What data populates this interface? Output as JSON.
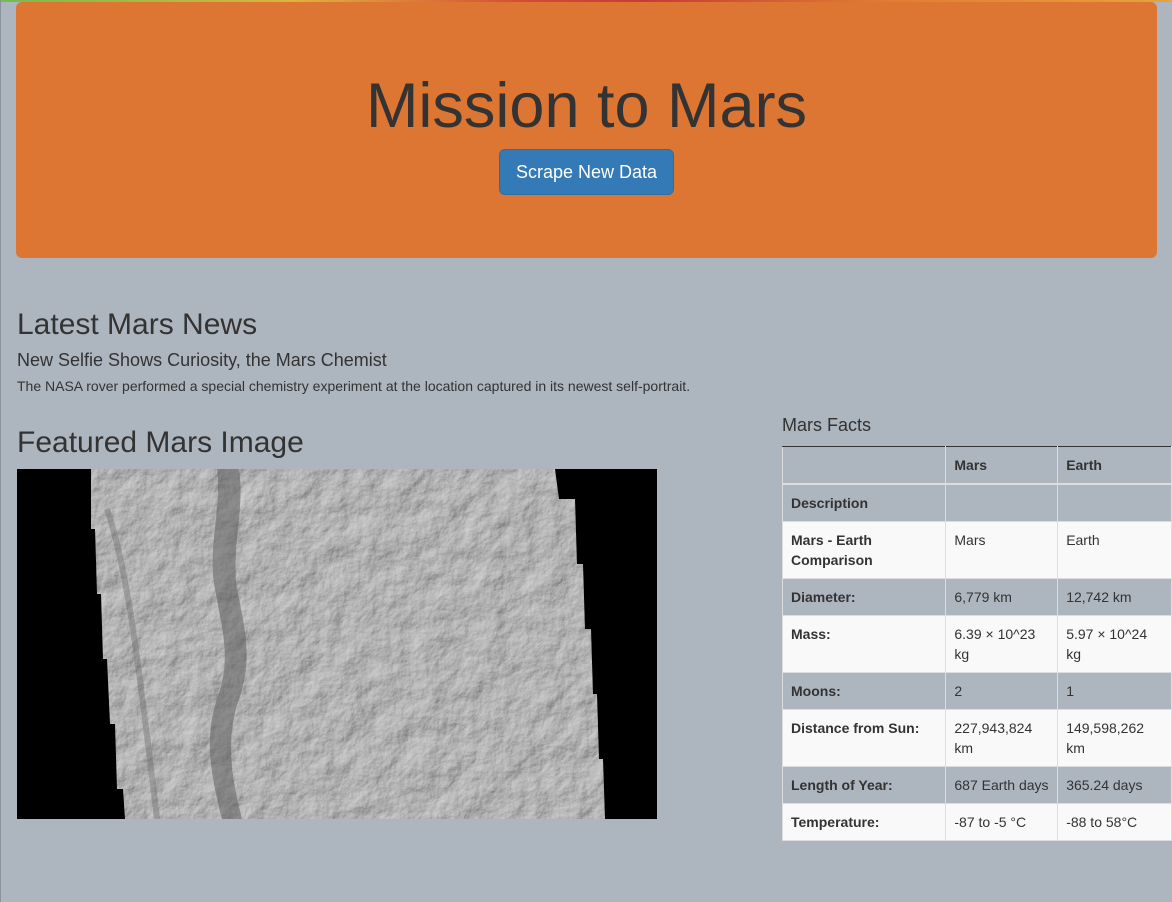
{
  "header": {
    "title": "Mission to Mars",
    "scrape_button_label": "Scrape New Data"
  },
  "news": {
    "heading": "Latest Mars News",
    "title": "New Selfie Shows Curiosity, the Mars Chemist",
    "paragraph": "The NASA rover performed a special chemistry experiment at the location captured in its newest self-portrait."
  },
  "featured_image": {
    "heading": "Featured Mars Image"
  },
  "facts": {
    "heading": "Mars Facts",
    "columns": [
      "",
      "Mars",
      "Earth"
    ],
    "rows": [
      {
        "label": "Description",
        "mars": "",
        "earth": ""
      },
      {
        "label": "Mars - Earth Comparison",
        "mars": "Mars",
        "earth": "Earth"
      },
      {
        "label": "Diameter:",
        "mars": "6,779 km",
        "earth": "12,742 km"
      },
      {
        "label": "Mass:",
        "mars": "6.39 × 10^23 kg",
        "earth": "5.97 × 10^24 kg"
      },
      {
        "label": "Moons:",
        "mars": "2",
        "earth": "1"
      },
      {
        "label": "Distance from Sun:",
        "mars": "227,943,824 km",
        "earth": "149,598,262 km"
      },
      {
        "label": "Length of Year:",
        "mars": "687 Earth days",
        "earth": "365.24 days"
      },
      {
        "label": "Temperature:",
        "mars": "-87 to -5 °C",
        "earth": "-88 to 58°C"
      }
    ]
  },
  "colors": {
    "page_background": "#adb5bf",
    "jumbotron": "#de7633",
    "button": "#337ab7",
    "text": "#333333"
  }
}
